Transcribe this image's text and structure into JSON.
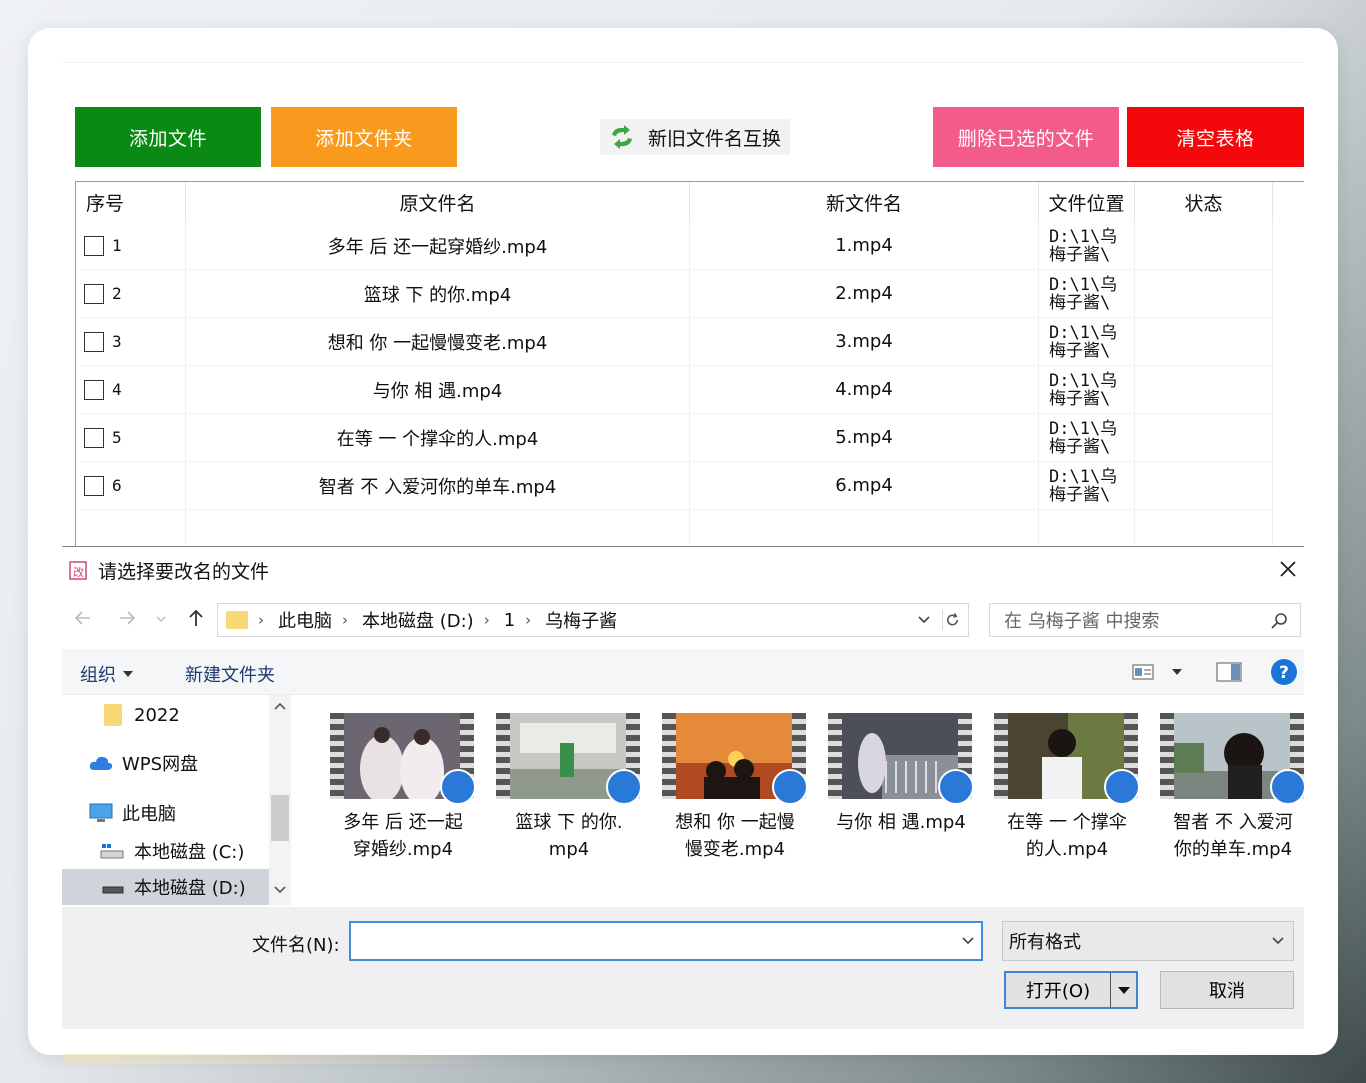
{
  "toolbar": {
    "add_file": "添加文件",
    "add_folder": "添加文件夹",
    "swap": "新旧文件名互换",
    "delete_selected": "删除已选的文件",
    "clear_table": "清空表格"
  },
  "colors": {
    "add_file": "#0a8a14",
    "add_folder": "#f79a1e",
    "delete_selected": "#f25b8a",
    "clear_table": "#f4080c"
  },
  "table": {
    "headers": [
      "序号",
      "原文件名",
      "新文件名",
      "文件位置",
      "状态"
    ],
    "rows": [
      {
        "seq": "1",
        "orig": "多年 后 还一起穿婚纱.mp4",
        "new": "1.mp4",
        "loc": "D:\\1\\乌\n梅子酱\\",
        "status": ""
      },
      {
        "seq": "2",
        "orig": "篮球 下 的你.mp4",
        "new": "2.mp4",
        "loc": "D:\\1\\乌\n梅子酱\\",
        "status": ""
      },
      {
        "seq": "3",
        "orig": "想和 你 一起慢慢变老.mp4",
        "new": "3.mp4",
        "loc": "D:\\1\\乌\n梅子酱\\",
        "status": ""
      },
      {
        "seq": "4",
        "orig": "与你 相 遇.mp4",
        "new": "4.mp4",
        "loc": "D:\\1\\乌\n梅子酱\\",
        "status": ""
      },
      {
        "seq": "5",
        "orig": "在等 一 个撑伞的人.mp4",
        "new": "5.mp4",
        "loc": "D:\\1\\乌\n梅子酱\\",
        "status": ""
      },
      {
        "seq": "6",
        "orig": "智者 不 入爱河你的单车.mp4",
        "new": "6.mp4",
        "loc": "D:\\1\\乌\n梅子酱\\",
        "status": ""
      }
    ]
  },
  "dialog": {
    "title": "请选择要改名的文件",
    "breadcrumb": [
      "此电脑",
      "本地磁盘 (D:)",
      "1",
      "乌梅子酱"
    ],
    "search_placeholder": "在 乌梅子酱 中搜索",
    "organize": "组织",
    "new_folder": "新建文件夹",
    "nav": [
      {
        "label": "2022",
        "icon": "folder-icon"
      },
      {
        "label": "WPS网盘",
        "icon": "cloud-icon"
      },
      {
        "label": "此电脑",
        "icon": "computer-icon"
      },
      {
        "label": "本地磁盘 (C:)",
        "icon": "drive-icon"
      },
      {
        "label": "本地磁盘 (D:)",
        "icon": "drive-icon"
      }
    ],
    "files": [
      {
        "name": "多年 后 还一起\n穿婚纱.mp4"
      },
      {
        "name": "篮球 下 的你.\nmp4"
      },
      {
        "name": "想和 你 一起慢\n慢变老.mp4"
      },
      {
        "name": "与你 相 遇.mp4"
      },
      {
        "name": "在等 一 个撑伞\n的人.mp4"
      },
      {
        "name": "智者 不 入爱河\n你的单车.mp4"
      }
    ],
    "filename_label": "文件名(N):",
    "filename_value": "",
    "filetype": "所有格式",
    "open": "打开(O)",
    "cancel": "取消"
  }
}
